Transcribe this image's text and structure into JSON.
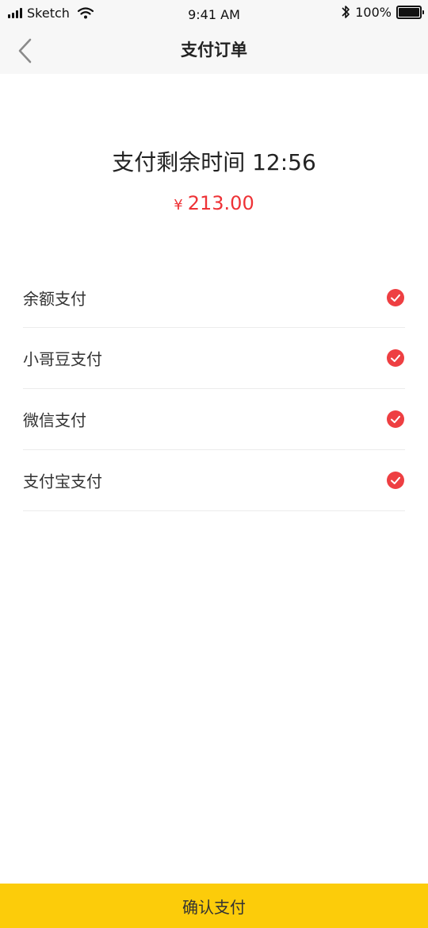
{
  "status_bar": {
    "carrier": "Sketch",
    "time": "9:41 AM",
    "battery": "100%"
  },
  "nav": {
    "title": "支付订单"
  },
  "payment": {
    "timer_label": "支付剩余时间",
    "timer_value": "12:56",
    "currency": "¥",
    "amount": "213.00"
  },
  "methods": [
    {
      "label": "余额支付",
      "selected": true
    },
    {
      "label": "小哥豆支付",
      "selected": true
    },
    {
      "label": "微信支付",
      "selected": true
    },
    {
      "label": "支付宝支付",
      "selected": true
    }
  ],
  "confirm_label": "确认支付",
  "colors": {
    "accent_red": "#ee3236",
    "button_yellow": "#fccc0a"
  }
}
